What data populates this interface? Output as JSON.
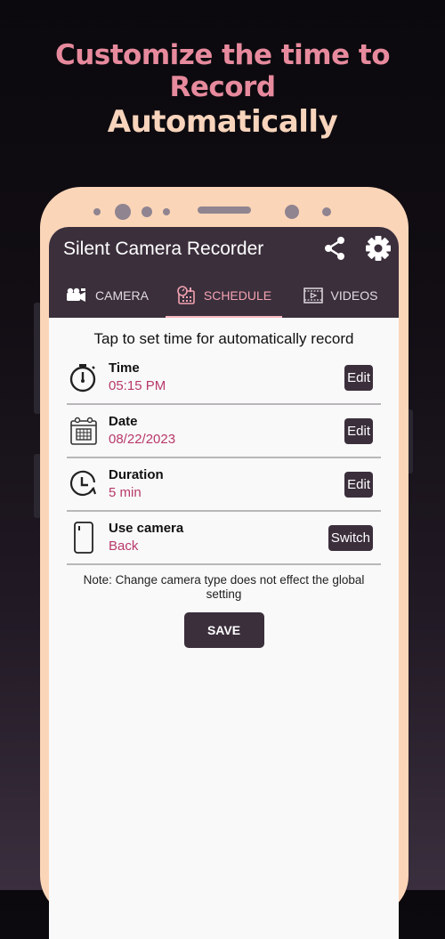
{
  "promo": {
    "headline_line1": "Customize the time to Record",
    "headline_line2": "Automatically"
  },
  "app": {
    "title": "Silent Camera Recorder",
    "actions": [
      {
        "icon": "share-icon"
      },
      {
        "icon": "gear-icon"
      }
    ],
    "tabs": [
      {
        "label": "CAMERA",
        "icon": "video-camera-icon",
        "active": false
      },
      {
        "label": "SCHEDULE",
        "icon": "schedule-calendar-icon",
        "active": true
      },
      {
        "label": "VIDEOS",
        "icon": "video-film-icon",
        "active": false
      }
    ]
  },
  "schedule": {
    "instruction": "Tap to set time for automatically record",
    "rows": [
      {
        "label": "Time",
        "value": "05:15 PM",
        "button": "Edit",
        "icon": "stopwatch-icon"
      },
      {
        "label": "Date",
        "value": "08/22/2023",
        "button": "Edit",
        "icon": "calendar-icon"
      },
      {
        "label": "Duration",
        "value": "5 min",
        "button": "Edit",
        "icon": "clock-refresh-icon"
      },
      {
        "label": "Use camera",
        "value": "Back",
        "button": "Switch",
        "icon": "phone-icon"
      }
    ],
    "note": "Note: Change camera type does not effect the global setting",
    "save_label": "SAVE"
  },
  "colors": {
    "accent": "#b8386a",
    "appbar": "#3b2f3c",
    "phone_frame": "#fbd5b8",
    "headline_pink": "#e78a9d",
    "headline_peach": "#f7d4bb"
  }
}
